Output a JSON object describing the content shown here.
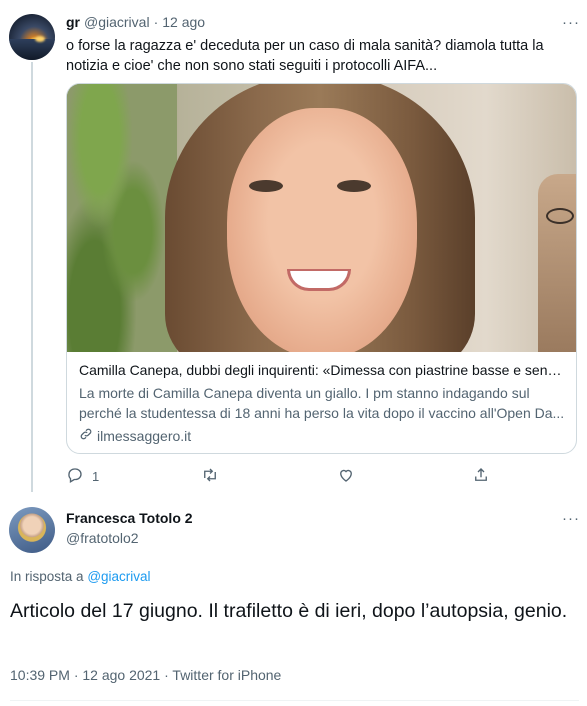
{
  "tweet1": {
    "name": "gr",
    "handle": "@giacrival",
    "separator": "·",
    "time": "12 ago",
    "more": "···",
    "text": "o forse la ragazza e' deceduta per un caso di mala sanità? diamola tutta la notizia e cioe' che non sono stati seguiti i protocolli AIFA...",
    "card": {
      "title": "Camilla Canepa, dubbi degli inquirenti: «Dimessa con piastrine basse e senza...",
      "description": "La morte di Camilla Canepa diventa un giallo. I pm stanno indagando sul perché la studentessa di 18 anni ha perso la vita dopo il vaccino all'Open Da...",
      "domain": "ilmessaggero.it"
    },
    "actions": {
      "reply_count": "1",
      "retweet_count": "",
      "like_count": ""
    }
  },
  "tweet2": {
    "name": "Francesca Totolo 2",
    "handle": "@fratotolo2",
    "more": "···",
    "reply_prefix": "In risposta a",
    "reply_handle": "@giacrival",
    "text": "Articolo del 17 giugno. Il trafiletto è di ieri, dopo l’autopsia, genio.",
    "meta": "10:39 PM · 12 ago 2021 · Twitter for iPhone"
  },
  "colors": {
    "text": "#0f1419",
    "secondary": "#536471",
    "link": "#1d9bf0",
    "border": "#cfd9de"
  },
  "icons": [
    "reply-icon",
    "retweet-icon",
    "like-icon",
    "share-icon",
    "link-icon",
    "more-icon"
  ]
}
